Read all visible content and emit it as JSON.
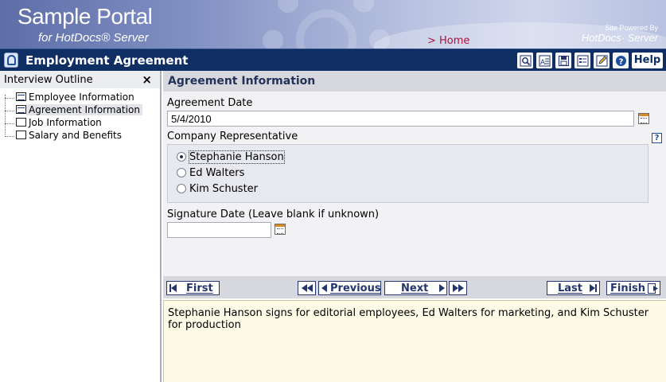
{
  "banner": {
    "title": "Sample Portal",
    "subtitle": "for HotDocs® Server",
    "home_link": "> Home",
    "powered_line1": "Site Powered By",
    "powered_line2": "HotDocs· Server"
  },
  "titlebar": {
    "title": "Employment Agreement",
    "toolbar_icons": [
      "preview-icon",
      "answer-summary-icon",
      "save-icon",
      "answer-file-icon",
      "edit-icon",
      "info-icon"
    ],
    "help_label": "Help"
  },
  "outline": {
    "header": "Interview Outline",
    "close_glyph": "×",
    "items": [
      {
        "label": "Employee Information",
        "selected": false
      },
      {
        "label": "Agreement Information",
        "selected": true
      },
      {
        "label": "Job Information",
        "selected": false
      },
      {
        "label": "Salary and Benefits",
        "selected": false
      }
    ]
  },
  "dialog": {
    "title": "Agreement Information",
    "agreement_date_label": "Agreement Date",
    "agreement_date_value": "5/4/2010",
    "rep_label": "Company Representative",
    "rep_options": [
      "Stephanie Hanson",
      "Ed Walters",
      "Kim Schuster"
    ],
    "rep_selected": "Stephanie Hanson",
    "signature_date_label": "Signature Date (Leave blank if unknown)",
    "signature_date_value": "",
    "help_glyph": "?"
  },
  "navigation": {
    "first_label": "First",
    "previous_label": "Previous",
    "next_label": "Next",
    "last_label": "Last",
    "finish_label": "Finish"
  },
  "help_text": "Stephanie Hanson signs for editorial employees, Ed Walters for marketing, and Kim Schuster for production",
  "colors": {
    "titlebar": "#0f2f64",
    "accent": "#23356c",
    "home_link": "#b0123a",
    "help_background": "#fdfbe6"
  }
}
